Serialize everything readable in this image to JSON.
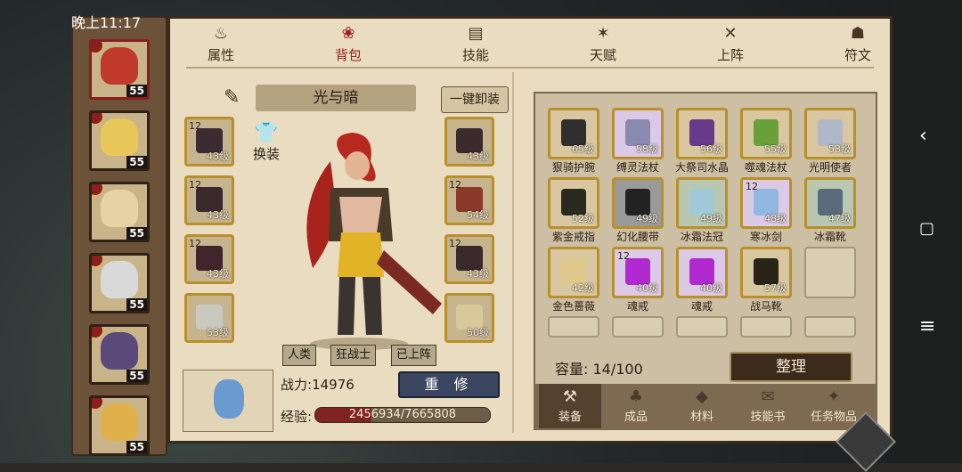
{
  "status": {
    "clock": "晚上11:17"
  },
  "side_nav": {
    "back": "‹",
    "home": "▢",
    "menu": "≡"
  },
  "tabs": [
    {
      "label": "属性",
      "icon": "flame-icon"
    },
    {
      "label": "背包",
      "icon": "bag-icon",
      "active": true
    },
    {
      "label": "技能",
      "icon": "book-icon"
    },
    {
      "label": "天赋",
      "icon": "star-icon"
    },
    {
      "label": "上阵",
      "icon": "swords-icon"
    },
    {
      "label": "符文",
      "icon": "rune-icon"
    }
  ],
  "heroes": [
    {
      "level": "55",
      "selected": true,
      "color": "#c0392b"
    },
    {
      "level": "55",
      "color": "#e8c85a"
    },
    {
      "level": "55",
      "color": "#e6d3a3"
    },
    {
      "level": "55",
      "color": "#d9d9d9"
    },
    {
      "level": "55",
      "color": "#5a4a7a"
    },
    {
      "level": "55",
      "color": "#e0b04a"
    }
  ],
  "equip": {
    "set_name": "光与暗",
    "unequip_all": "一键卸装",
    "swap": "换装",
    "left_slots": [
      {
        "upgrade": "12",
        "level": "43级",
        "color": "#3a2c30"
      },
      {
        "upgrade": "12",
        "level": "43级",
        "color": "#3a2a2c"
      },
      {
        "upgrade": "12",
        "level": "43级",
        "color": "#40262c"
      },
      {
        "upgrade": "",
        "level": "53级",
        "color": "#c9c9c0"
      }
    ],
    "right_slots": [
      {
        "upgrade": "",
        "level": "43级",
        "color": "#3a2a2c"
      },
      {
        "upgrade": "12",
        "level": "54级",
        "color": "#8a3a2a"
      },
      {
        "upgrade": "12",
        "level": "43级",
        "color": "#3a2a2c"
      },
      {
        "upgrade": "",
        "level": "50级",
        "color": "#d8c89a"
      }
    ],
    "tags": [
      "人类",
      "狂战士",
      "已上阵"
    ],
    "power_label": "战力:",
    "power_value": "14976",
    "repair": "重 修",
    "exp_label": "经验:",
    "exp_text": "2456934/7665808",
    "exp_ratio": 0.3205
  },
  "inventory": {
    "items": [
      {
        "name": "狠骑护腕",
        "level": "65级",
        "color": "#2f2f2f"
      },
      {
        "name": "缚灵法杖",
        "level": "58级",
        "color": "#8a8ab0",
        "purple": true
      },
      {
        "name": "大祭司水晶",
        "level": "56级",
        "color": "#6a3a8a"
      },
      {
        "name": "噬魂法杖",
        "level": "55级",
        "color": "#6aa03a"
      },
      {
        "name": "光明使者",
        "level": "53级",
        "color": "#b0b8c8"
      },
      {
        "name": "紫金戒指",
        "level": "52级",
        "color": "#2a2a20"
      },
      {
        "name": "幻化腰带",
        "level": "49级",
        "color": "#222222",
        "gray": true
      },
      {
        "name": "冰霜法冠",
        "level": "49级",
        "color": "#a0c8d8",
        "green": true
      },
      {
        "name": "寒冰剑",
        "level": "48级",
        "upgrade": "12",
        "color": "#90b8e0",
        "purple": true
      },
      {
        "name": "冰霜靴",
        "level": "47级",
        "color": "#5a6a7a",
        "green": true
      },
      {
        "name": "金色蔷薇",
        "level": "42级",
        "color": "#e0c88a"
      },
      {
        "name": "魂戒",
        "level": "40级",
        "upgrade": "12",
        "color": "#b02ad0",
        "purple": true
      },
      {
        "name": "魂戒",
        "level": "40级",
        "color": "#b02ad0",
        "purple": true
      },
      {
        "name": "战马靴",
        "level": "57级",
        "color": "#2a2418"
      },
      {
        "name": "",
        "level": "",
        "empty": true
      }
    ],
    "capacity_label": "容量:",
    "capacity_value": "14/100",
    "sort": "整理",
    "bottom_tabs": [
      {
        "label": "装备",
        "icon": "anvil-icon",
        "active": true
      },
      {
        "label": "成品",
        "icon": "pouch-icon"
      },
      {
        "label": "材料",
        "icon": "ore-icon"
      },
      {
        "label": "技能书",
        "icon": "scroll-icon"
      },
      {
        "label": "任务物品",
        "icon": "quest-icon"
      }
    ]
  }
}
